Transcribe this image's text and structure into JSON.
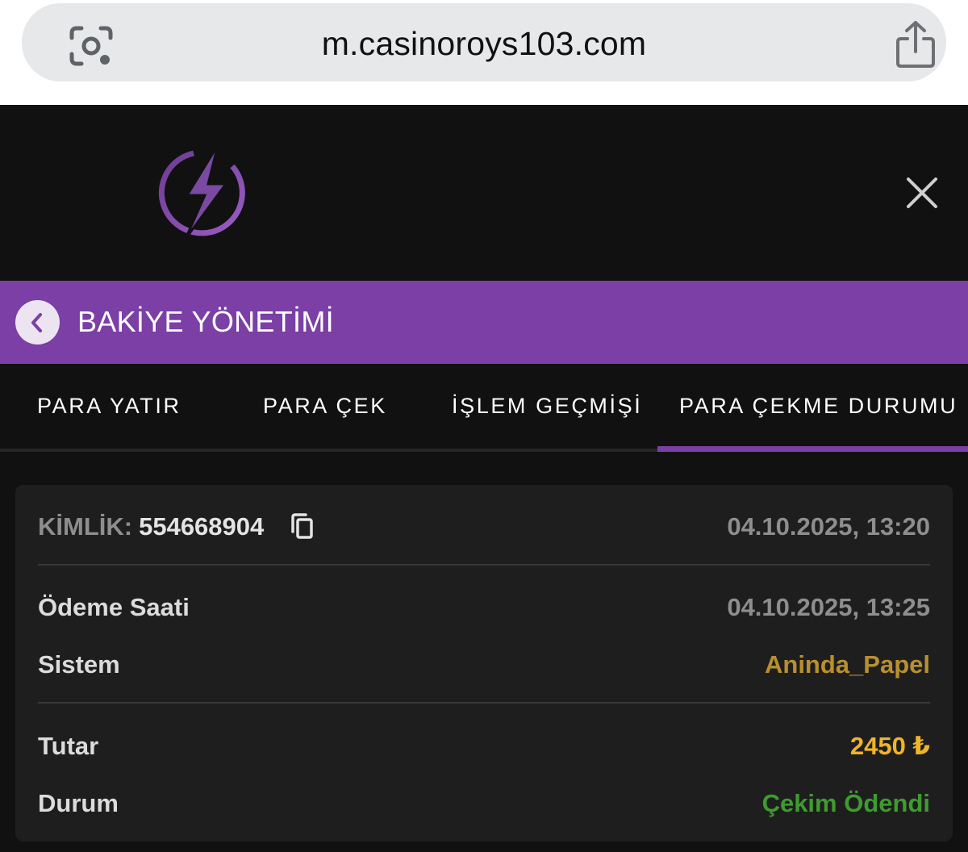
{
  "browser": {
    "url": "m.casinoroys103.com",
    "icons": [
      "camera-lens-icon",
      "share-icon"
    ]
  },
  "header": {
    "logo": "lightning-bolt-logo",
    "close_icon": "close-icon"
  },
  "title_bar": {
    "title": "BAKİYE YÖNETİMİ",
    "back_icon": "chevron-left-icon"
  },
  "tabs": [
    {
      "label": "PARA YATIR",
      "active": false
    },
    {
      "label": "PARA ÇEK",
      "active": false
    },
    {
      "label": "İŞLEM GEÇMİŞİ",
      "active": false
    },
    {
      "label": "PARA ÇEKME DURUMU",
      "active": true
    }
  ],
  "transaction": {
    "id_label": "KİMLİK:",
    "id_value": "554668904",
    "created": "04.10.2025, 13:20",
    "rows": [
      {
        "label": "Ödeme Saati",
        "value": "04.10.2025, 13:25"
      },
      {
        "label": "Sistem",
        "value": "Aninda_Papel"
      },
      {
        "label": "Tutar",
        "value": "2450 ₺"
      },
      {
        "label": "Durum",
        "value": "Çekim Ödendi"
      }
    ]
  },
  "colors": {
    "accent_purple": "#7b3fa5",
    "system_gold": "#b8902e",
    "amount_yellow": "#f0b429",
    "status_green": "#3f9b2f",
    "muted_grey": "#8e8e8e"
  }
}
